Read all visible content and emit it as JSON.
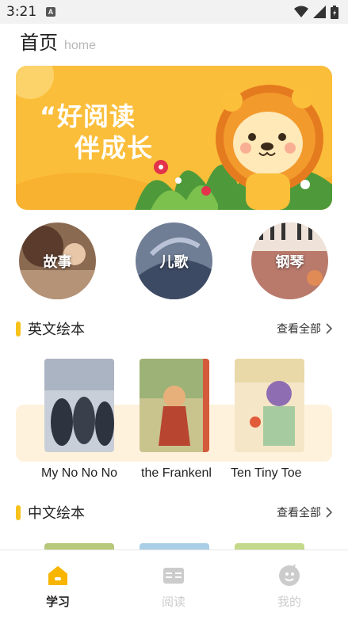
{
  "status_bar": {
    "time": "3:21",
    "notification_icon": "a-icon",
    "icons": [
      "wifi-icon",
      "signal-icon",
      "battery-icon"
    ]
  },
  "header": {
    "title": "首页",
    "subtitle": "home"
  },
  "banner": {
    "line1": "“好阅读",
    "line2": "伴成长",
    "art": "lion-illustration"
  },
  "categories": [
    {
      "label": "故事"
    },
    {
      "label": "儿歌"
    },
    {
      "label": "钢琴"
    }
  ],
  "english_section": {
    "title": "英文绘本",
    "more_label": "查看全部",
    "books": [
      {
        "title": "My No No No"
      },
      {
        "title": "the Frankenl"
      },
      {
        "title": "Ten Tiny Toe"
      }
    ]
  },
  "chinese_section": {
    "title": "中文绘本",
    "more_label": "查看全部"
  },
  "tabbar": {
    "tabs": [
      {
        "label": "学习",
        "icon": "home-icon",
        "active": true
      },
      {
        "label": "阅读",
        "icon": "book-icon",
        "active": false
      },
      {
        "label": "我的",
        "icon": "profile-icon",
        "active": false
      }
    ],
    "active_color": "#f7b500",
    "inactive_color": "#cccccc"
  },
  "colors": {
    "accent": "#f8c21c",
    "banner_bg": "#fbbe3a",
    "shelf_bg": "#fff2dc"
  }
}
